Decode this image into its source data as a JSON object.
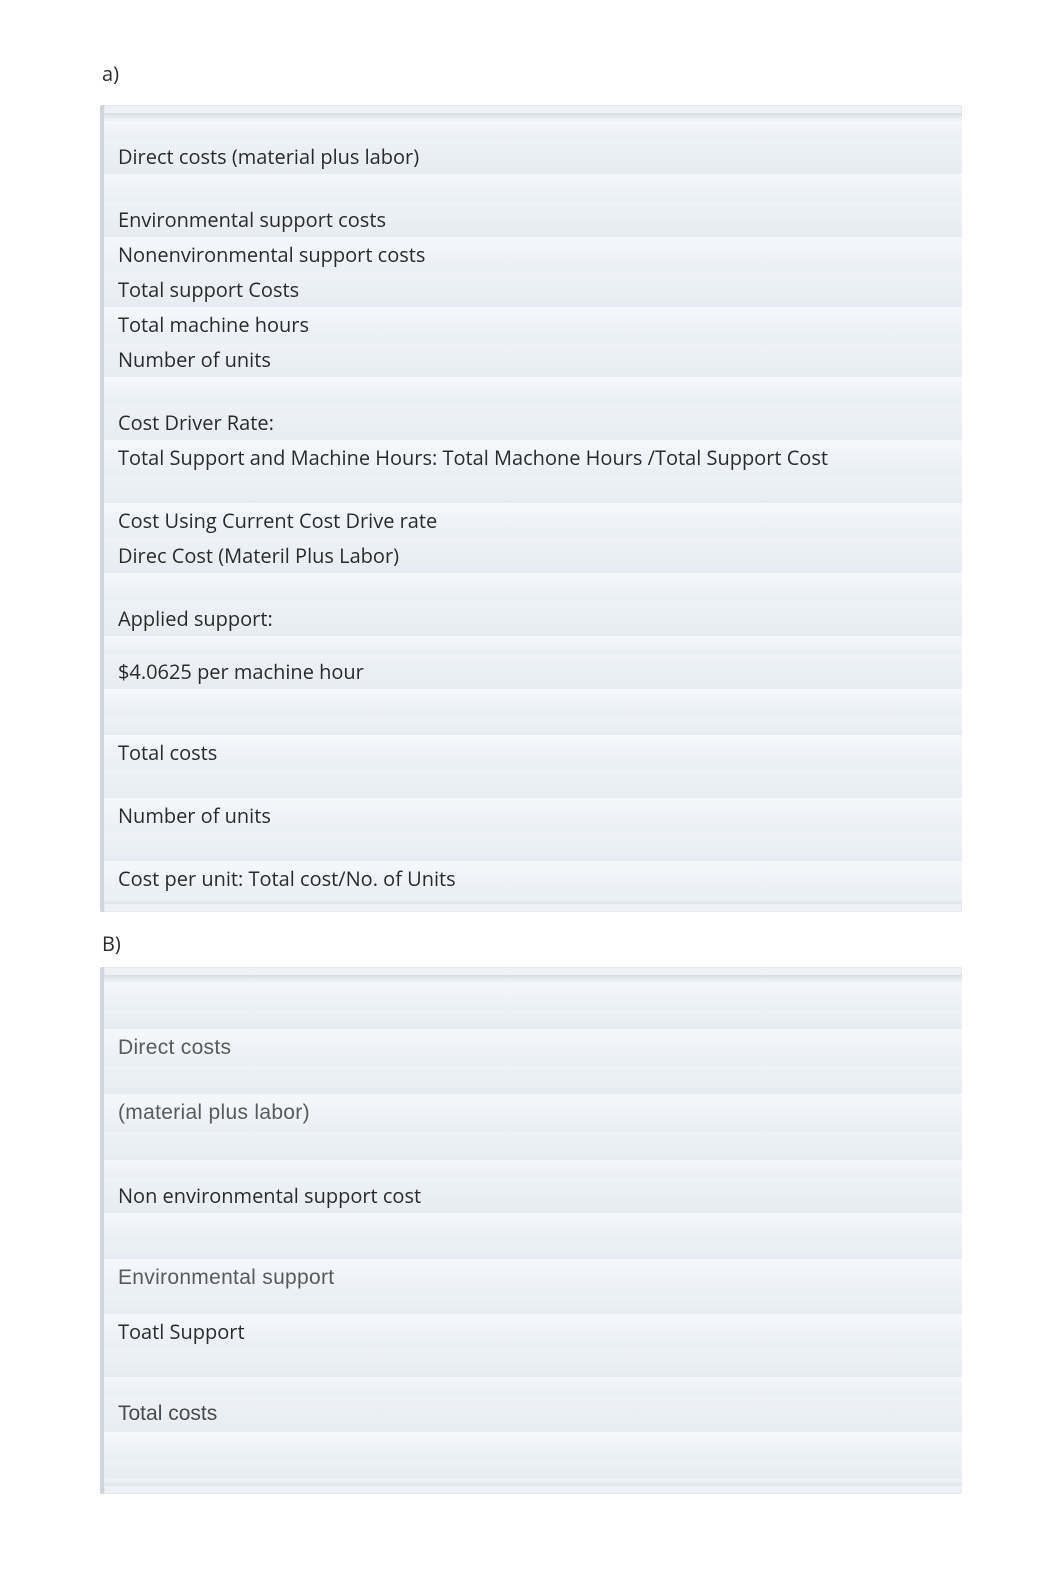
{
  "sectionA": {
    "label": "a)",
    "rows": {
      "direct_costs": "Direct costs (material plus labor)",
      "env_support": "Environmental support costs",
      "nonenv_support": "Nonenvironmental support costs",
      "total_support": "Total support Costs",
      "total_machine_hours": "Total machine hours",
      "num_units": "Number of units",
      "cost_driver_rate": "Cost Driver Rate:",
      "rate_formula": "Total Support and Machine Hours: Total Machone Hours /Total Support Cost",
      "cost_using_rate": "Cost Using Current Cost Drive rate",
      "direc_cost": "Direc Cost (Materil Plus Labor)",
      "applied_support": "Applied support:",
      "per_machine_hour": "$4.0625 per machine hour",
      "total_costs": "Total costs",
      "number_of_units": "Number of units",
      "cost_per_unit": "Cost per unit: Total cost/No. of Units"
    }
  },
  "sectionB": {
    "label": "B)",
    "rows": {
      "direct_costs": "Direct costs",
      "material_plus_labor": "(material plus labor)",
      "non_env_support_cost": "Non environmental support cost",
      "env_support": "Environmental support",
      "toatl_support": "Toatl Support",
      "total_costs": "Total costs"
    }
  }
}
